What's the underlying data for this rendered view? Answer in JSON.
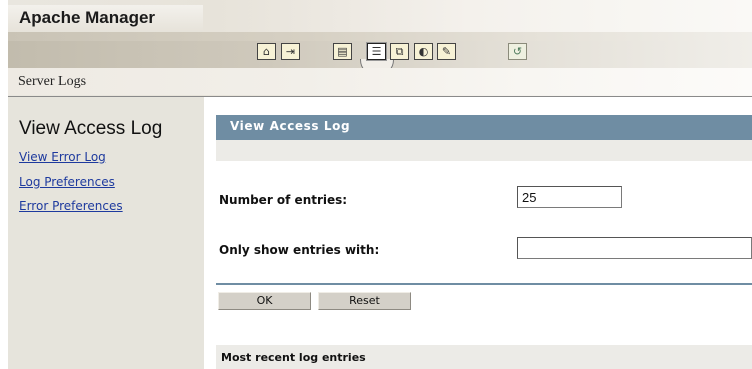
{
  "app": {
    "title": "Apache Manager"
  },
  "breadcrumb": {
    "label": "Server Logs"
  },
  "toolbar": {
    "icons": [
      {
        "name": "home-icon",
        "glyph": "⌂"
      },
      {
        "name": "exit-icon",
        "glyph": "⇥"
      },
      {
        "name": "modules-icon",
        "glyph": "▤"
      },
      {
        "name": "logs-icon",
        "glyph": "☰"
      },
      {
        "name": "virtual-hosts-icon",
        "glyph": "⧉"
      },
      {
        "name": "content-icon",
        "glyph": "◐"
      },
      {
        "name": "tasks-icon",
        "glyph": "✎"
      },
      {
        "name": "help-icon",
        "glyph": "↺"
      }
    ]
  },
  "sidebar": {
    "title": "View Access Log",
    "links": [
      {
        "label": "View Error Log"
      },
      {
        "label": "Log Preferences"
      },
      {
        "label": "Error Preferences"
      }
    ]
  },
  "main": {
    "section_title": "View Access Log",
    "fields": {
      "entries_label": "Number of entries:",
      "entries_value": "25",
      "filter_label": "Only show entries with:",
      "filter_value": ""
    },
    "buttons": {
      "ok": "OK",
      "reset": "Reset"
    },
    "recent_label": "Most recent log entries"
  },
  "colors": {
    "section_header": "#6f8da3",
    "sidebar_bg": "#e6e4dc",
    "link": "#1e3a9e"
  }
}
